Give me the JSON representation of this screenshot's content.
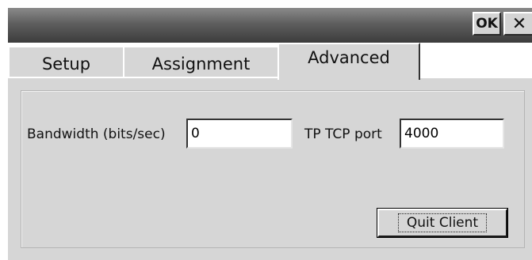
{
  "titlebar": {
    "ok_label": "OK",
    "close_icon": "close-icon",
    "close_glyph": "✕"
  },
  "tabs": [
    {
      "label": "Setup",
      "active": false
    },
    {
      "label": "Assignment",
      "active": false
    },
    {
      "label": "Advanced",
      "active": true
    }
  ],
  "advanced": {
    "bandwidth_label": "Bandwidth (bits/sec)",
    "bandwidth_value": "0",
    "tcp_port_label": "TP TCP port",
    "tcp_port_value": "4000",
    "quit_button_label": "Quit Client"
  },
  "colors": {
    "window_bg": "#d6d6d6",
    "titlebar_dark": "#3c3c3c"
  }
}
